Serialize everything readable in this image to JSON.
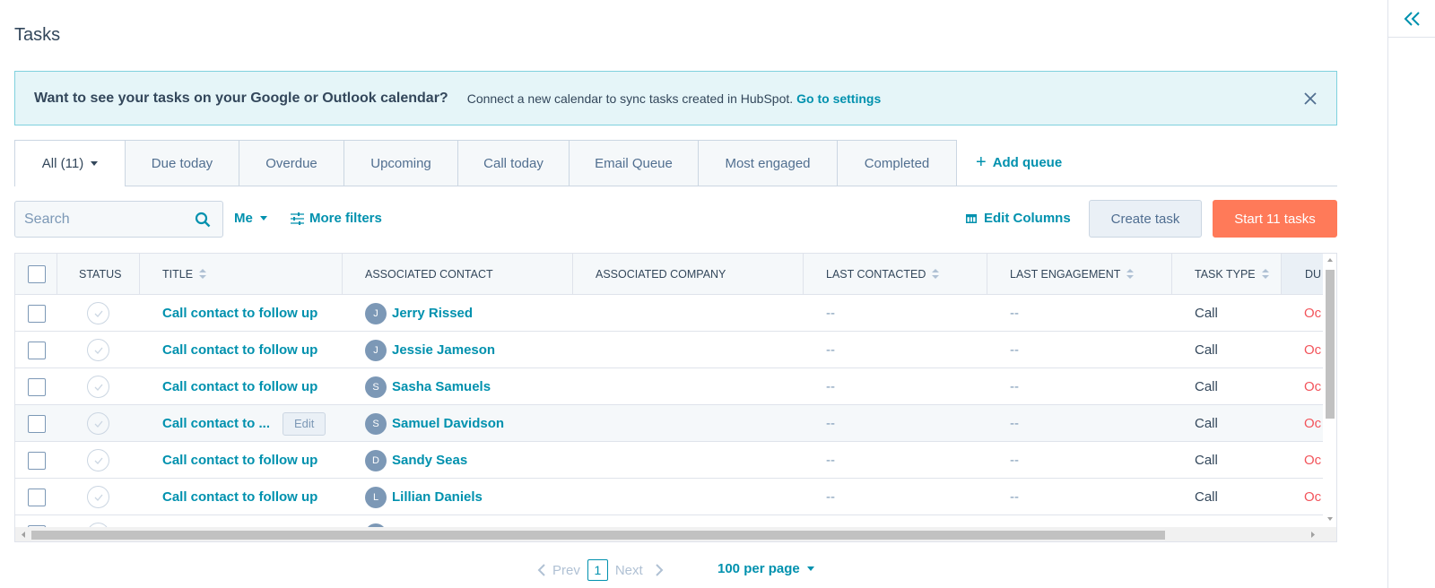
{
  "page": {
    "title": "Tasks"
  },
  "banner": {
    "heading": "Want to see your tasks on your Google or Outlook calendar?",
    "text": "Connect a new calendar to sync tasks created in HubSpot.",
    "link": "Go to settings"
  },
  "tabs": [
    {
      "label": "All (11)"
    },
    {
      "label": "Due today"
    },
    {
      "label": "Overdue"
    },
    {
      "label": "Upcoming"
    },
    {
      "label": "Call today"
    },
    {
      "label": "Email Queue"
    },
    {
      "label": "Most engaged"
    },
    {
      "label": "Completed"
    }
  ],
  "add_queue": "Add queue",
  "toolbar": {
    "search_placeholder": "Search",
    "owner_filter": "Me",
    "more_filters": "More filters",
    "edit_columns": "Edit Columns",
    "create_task": "Create task",
    "start_tasks": "Start 11 tasks"
  },
  "columns": [
    "STATUS",
    "TITLE",
    "ASSOCIATED CONTACT",
    "ASSOCIATED COMPANY",
    "LAST CONTACTED",
    "LAST ENGAGEMENT",
    "TASK TYPE",
    "DU"
  ],
  "rows": [
    {
      "title": "Call contact to follow up",
      "initial": "J",
      "contact": "Jerry Rissed",
      "company": "",
      "last_contacted": "--",
      "last_engagement": "--",
      "task_type": "Call",
      "due": "Oc"
    },
    {
      "title": "Call contact to follow up",
      "initial": "J",
      "contact": "Jessie Jameson",
      "company": "",
      "last_contacted": "--",
      "last_engagement": "--",
      "task_type": "Call",
      "due": "Oc"
    },
    {
      "title": "Call contact to follow up",
      "initial": "S",
      "contact": "Sasha Samuels",
      "company": "",
      "last_contacted": "--",
      "last_engagement": "--",
      "task_type": "Call",
      "due": "Oc"
    },
    {
      "title": "Call contact to ...",
      "edit": "Edit",
      "initial": "S",
      "contact": "Samuel Davidson",
      "company": "",
      "last_contacted": "--",
      "last_engagement": "--",
      "task_type": "Call",
      "due": "Oc"
    },
    {
      "title": "Call contact to follow up",
      "initial": "D",
      "contact": "Sandy Seas",
      "company": "",
      "last_contacted": "--",
      "last_engagement": "--",
      "task_type": "Call",
      "due": "Oc"
    },
    {
      "title": "Call contact to follow up",
      "initial": "L",
      "contact": "Lillian Daniels",
      "company": "",
      "last_contacted": "--",
      "last_engagement": "--",
      "task_type": "Call",
      "due": "Oc"
    }
  ],
  "pagination": {
    "prev": "Prev",
    "page": "1",
    "next": "Next",
    "per_page": "100 per page"
  }
}
